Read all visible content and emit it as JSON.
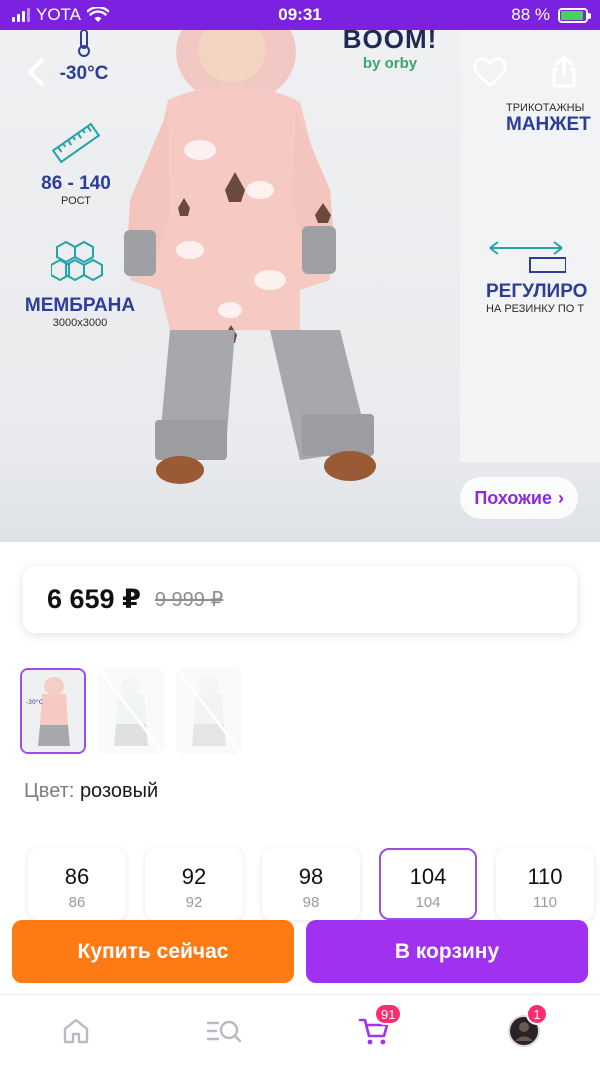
{
  "status_bar": {
    "carrier": "YOTA",
    "time": "09:31",
    "battery": "88 %"
  },
  "hero": {
    "features": {
      "temperature": "-30°C",
      "height_range": "86 - 140",
      "height_label": "РОСТ",
      "membrane": "МЕМБРАНА",
      "membrane_spec": "3000x3000",
      "cuffs_small": "ТРИКОТАЖНЫ",
      "cuffs": "МАНЖЕТ",
      "adjust": "РЕГУЛИРО",
      "adjust_small": "НА РЕЗИНКУ ПО Т"
    },
    "brand": {
      "logo": "BOOM!",
      "sub": "by orby"
    },
    "similar_label": "Похожие"
  },
  "price": {
    "current": "6 659 ₽",
    "old": "9 999 ₽"
  },
  "color": {
    "label": "Цвет:",
    "value": "розовый"
  },
  "sizes": [
    {
      "main": "86",
      "sub": "86",
      "selected": false
    },
    {
      "main": "92",
      "sub": "92",
      "selected": false
    },
    {
      "main": "98",
      "sub": "98",
      "selected": false
    },
    {
      "main": "104",
      "sub": "104",
      "selected": true
    },
    {
      "main": "110",
      "sub": "110",
      "selected": false
    }
  ],
  "actions": {
    "buy_now": "Купить сейчас",
    "add_to_cart": "В корзину"
  },
  "tabbar": {
    "cart_badge": "91",
    "profile_badge": "1"
  },
  "colors": {
    "brand_purple": "#a031f0",
    "orange": "#ff7a12",
    "badge": "#ff2d6f"
  },
  "icons": [
    "back-icon",
    "heart-icon",
    "share-icon",
    "home-icon",
    "catalog-search-icon",
    "cart-icon",
    "profile-avatar"
  ]
}
